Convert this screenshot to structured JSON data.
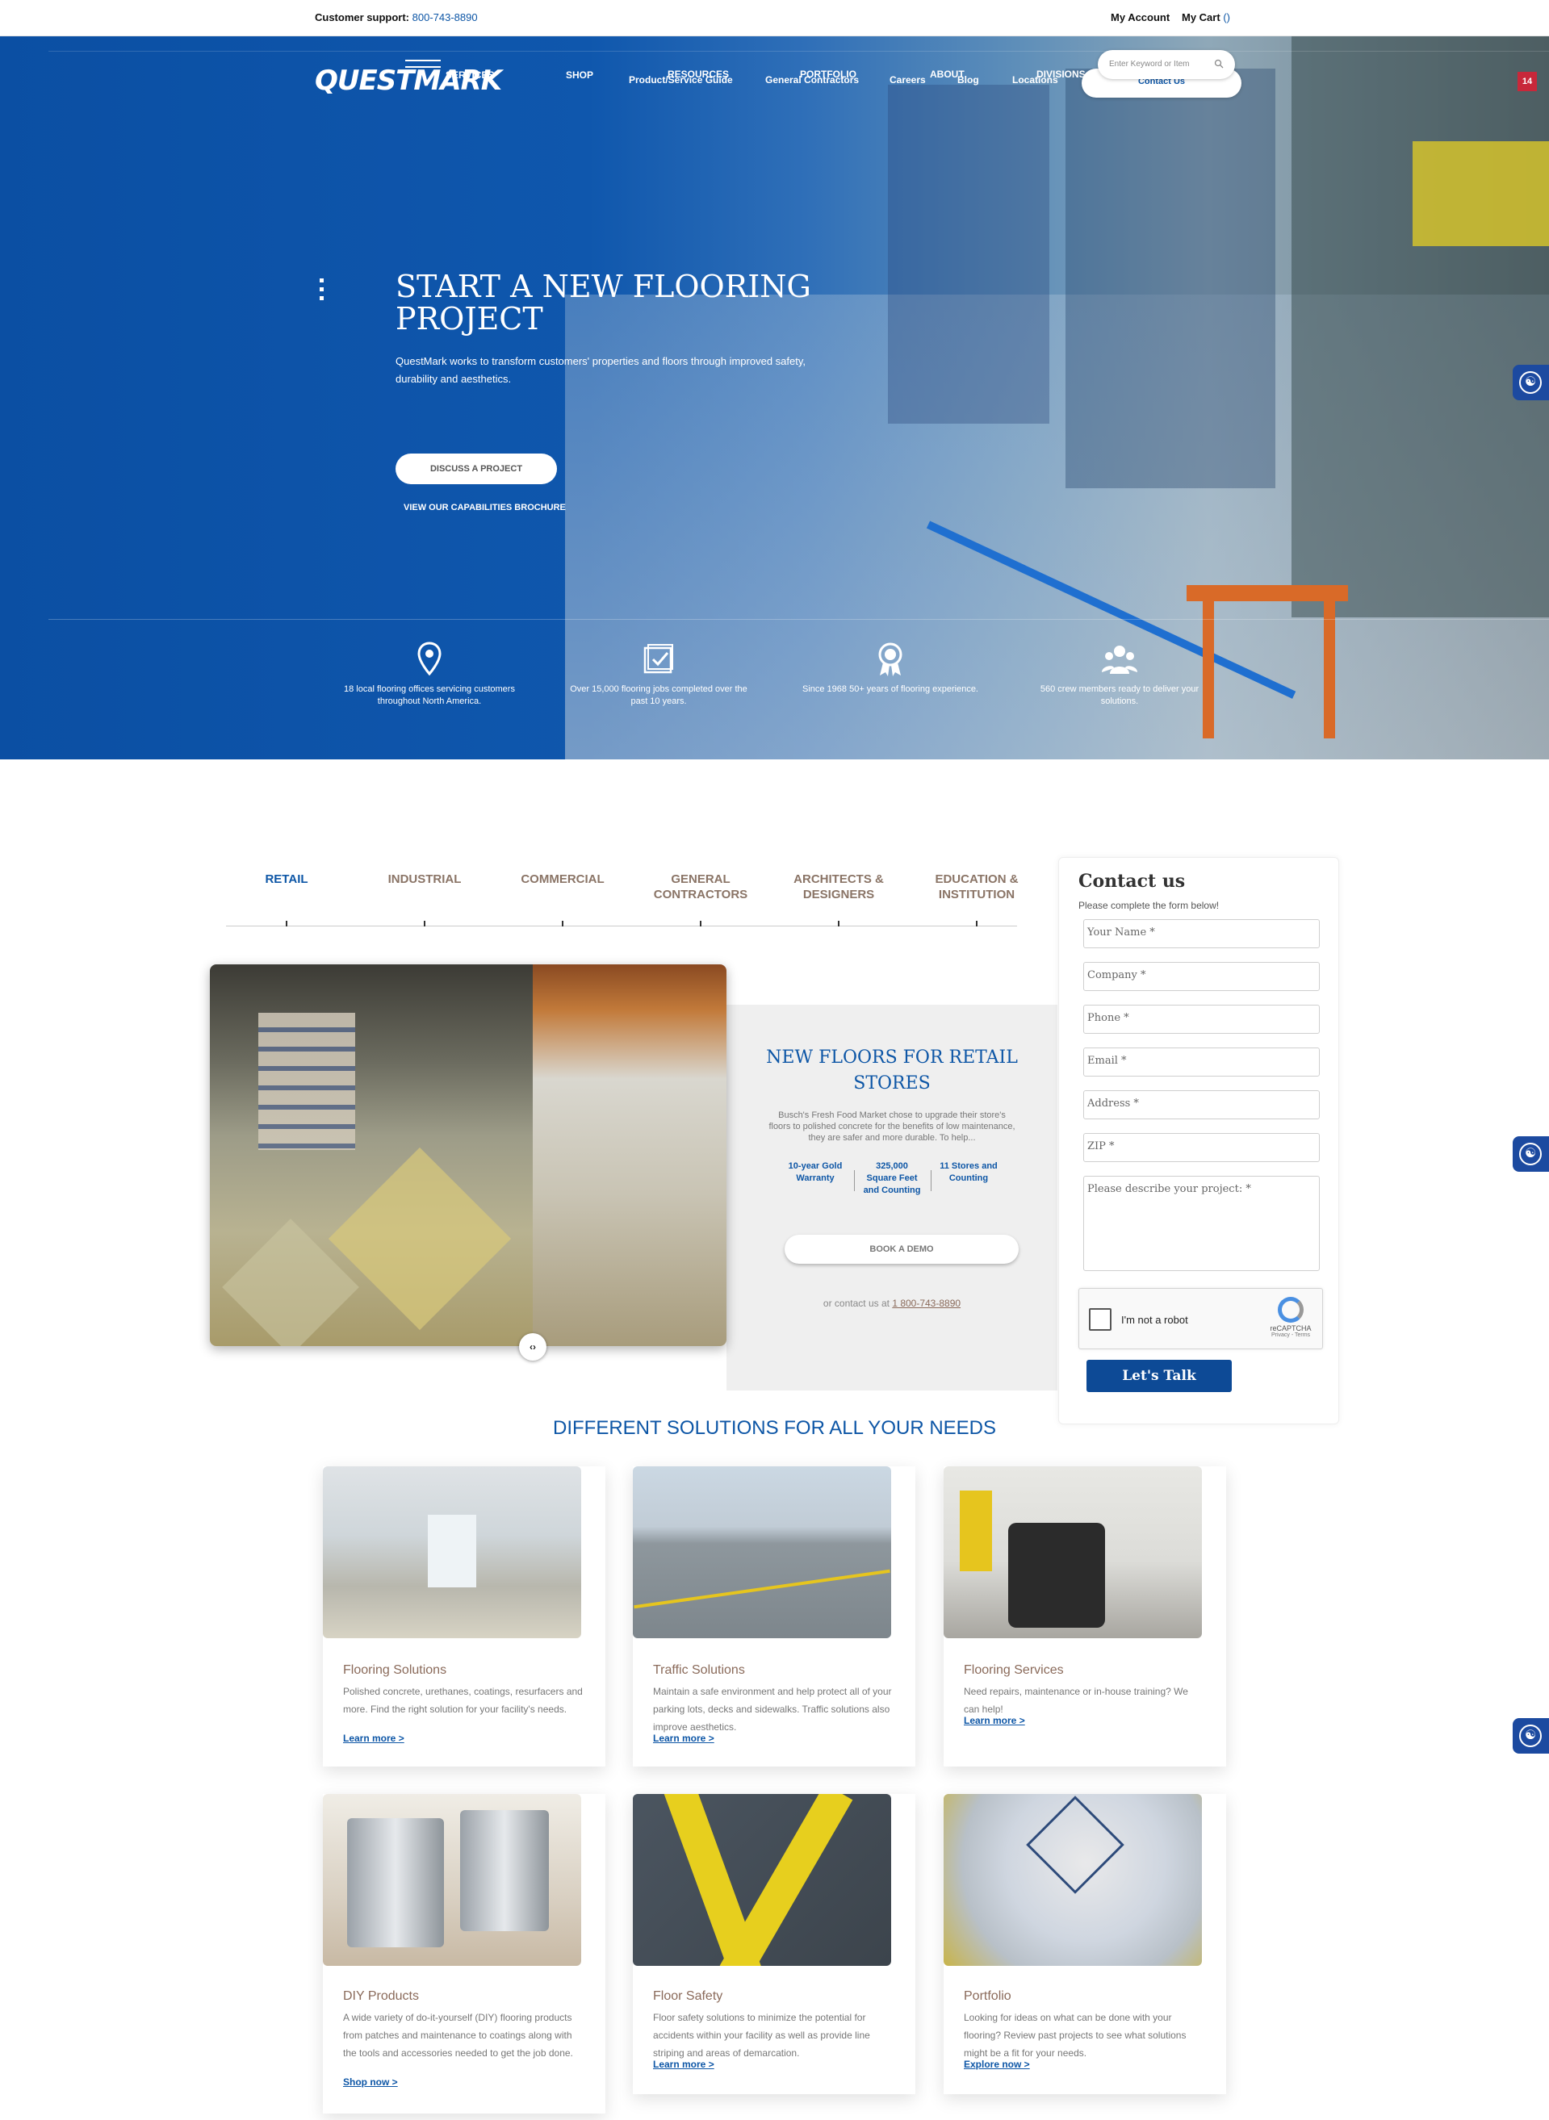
{
  "topbar": {
    "support_label": "Customer support:",
    "support_phone": "800-743-8890",
    "my_account": "My Account",
    "my_cart": "My Cart",
    "cart_count": "()"
  },
  "header": {
    "logo_text": "QUESTMARK",
    "nav": {
      "shop": "SHOP",
      "services": "SERVICES",
      "resources": "RESOURCES",
      "portfolio": "PORTFOLIO",
      "about": "ABOUT",
      "divisions": "DIVISIONS",
      "product_guide": "Product/Service Guide",
      "general_contractors": "General Contractors",
      "careers": "Careers",
      "blog": "Blog",
      "locations": "Locations"
    },
    "search_placeholder": "Enter Keyword or Item",
    "contact_us": "Contact Us",
    "badge": "14"
  },
  "hero": {
    "title": "START A NEW FLOORING PROJECT",
    "subtitle": "QuestMark works to transform customers' properties and floors through improved safety, durability and aesthetics.",
    "cta_button": "DISCUSS A PROJECT",
    "brochure_link": "VIEW OUR CAPABILITIES BROCHURE",
    "stats": [
      {
        "icon": "map-pin-icon",
        "text": "18 local flooring offices servicing customers throughout North America."
      },
      {
        "icon": "clipboard-check-icon",
        "text": "Over 15,000 flooring jobs completed over the past 10 years."
      },
      {
        "icon": "award-ribbon-icon",
        "text": "Since 1968 50+ years of flooring experience."
      },
      {
        "icon": "crew-group-icon",
        "text": "560 crew members ready to deliver your solutions."
      }
    ]
  },
  "tabs": [
    {
      "label": "RETAIL",
      "active": true
    },
    {
      "label": "INDUSTRIAL",
      "active": false
    },
    {
      "label": "COMMERCIAL",
      "active": false
    },
    {
      "label": "GENERAL CONTRACTORS",
      "active": false
    },
    {
      "label": "ARCHITECTS & DESIGNERS",
      "active": false
    },
    {
      "label": "EDUCATION & INSTITUTION",
      "active": false
    }
  ],
  "feature": {
    "title": "NEW FLOORS FOR RETAIL STORES",
    "description": "Busch's Fresh Food Market chose to upgrade their store's floors to polished concrete for the benefits of low maintenance, they are safer and more durable. To help...",
    "stats": [
      "10-year Gold Warranty",
      "325,000 Square Feet and Counting",
      "11 Stores and Counting"
    ],
    "button": "BOOK A DEMO",
    "contact_prefix": "or contact us at",
    "contact_phone": "1 800-743-8890"
  },
  "contact_form": {
    "title": "Contact us",
    "subtitle": "Please complete the form below!",
    "fields": [
      "Your Name *",
      "Company *",
      "Phone *",
      "Email *",
      "Address *",
      "ZIP *"
    ],
    "textarea": "Please describe your project: *",
    "captcha_label": "I'm not a robot",
    "captcha_brand": "reCAPTCHA",
    "captcha_links": "Privacy - Terms",
    "submit": "Let's Talk Flooring!"
  },
  "solutions": {
    "title": "DIFFERENT SOLUTIONS FOR ALL YOUR NEEDS",
    "cards": [
      {
        "title": "Flooring Solutions",
        "desc": "Polished concrete, urethanes, coatings, resurfacers and more. Find the right solution for your facility's needs.",
        "link": "Learn more >"
      },
      {
        "title": "Traffic Solutions",
        "desc": "Maintain a safe environment and help protect all of your parking lots, decks and sidewalks. Traffic solutions also improve aesthetics.",
        "link": "Learn more >"
      },
      {
        "title": "Flooring Services",
        "desc": "Need repairs, maintenance or in-house training? We can help!",
        "link": "Learn more >"
      },
      {
        "title": "DIY Products",
        "desc": "A wide variety of do-it-yourself (DIY) flooring products from patches and maintenance to coatings along with the tools and accessories needed to get the job done.",
        "link": "Shop now >"
      },
      {
        "title": "Floor Safety",
        "desc": "Floor safety solutions to minimize the potential for accidents within your facility as well as provide line striping and areas of demarcation.",
        "link": "Learn more >"
      },
      {
        "title": "Portfolio",
        "desc": "Looking for ideas on what can be done with your flooring? Review past projects to see what solutions might be a fit for your needs.",
        "link": "Explore now >"
      }
    ]
  },
  "colors": {
    "brand_blue": "#0d56a6",
    "accent_brown": "#8a6a5a",
    "submit_blue": "#0d4a96"
  }
}
